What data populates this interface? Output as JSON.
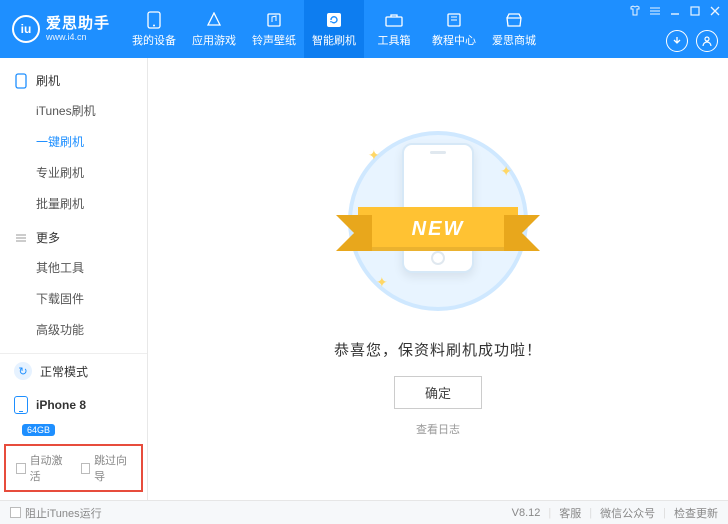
{
  "logo": {
    "iu": "iu",
    "title": "爱思助手",
    "sub": "www.i4.cn"
  },
  "nav": [
    {
      "label": "我的设备",
      "icon": "phone"
    },
    {
      "label": "应用游戏",
      "icon": "appstore"
    },
    {
      "label": "铃声壁纸",
      "icon": "music"
    },
    {
      "label": "智能刷机",
      "icon": "refresh",
      "active": true
    },
    {
      "label": "工具箱",
      "icon": "toolbox"
    },
    {
      "label": "教程中心",
      "icon": "book"
    },
    {
      "label": "爱思商城",
      "icon": "shop"
    }
  ],
  "sidebar": {
    "sections": [
      {
        "title": "刷机",
        "items": [
          "iTunes刷机",
          "一键刷机",
          "专业刷机",
          "批量刷机"
        ],
        "activeIndex": 1
      },
      {
        "title": "更多",
        "items": [
          "其他工具",
          "下载固件",
          "高级功能"
        ]
      }
    ],
    "mode": "正常模式",
    "device": {
      "name": "iPhone 8",
      "storage": "64GB"
    },
    "checks": {
      "autoActivate": "自动激活",
      "skipGuide": "跳过向导"
    }
  },
  "main": {
    "ribbon": "NEW",
    "success": "恭喜您，保资料刷机成功啦！",
    "confirm": "确定",
    "logLink": "查看日志"
  },
  "status": {
    "preventItunes": "阻止iTunes运行",
    "version": "V8.12",
    "support": "客服",
    "wechat": "微信公众号",
    "update": "检查更新"
  }
}
